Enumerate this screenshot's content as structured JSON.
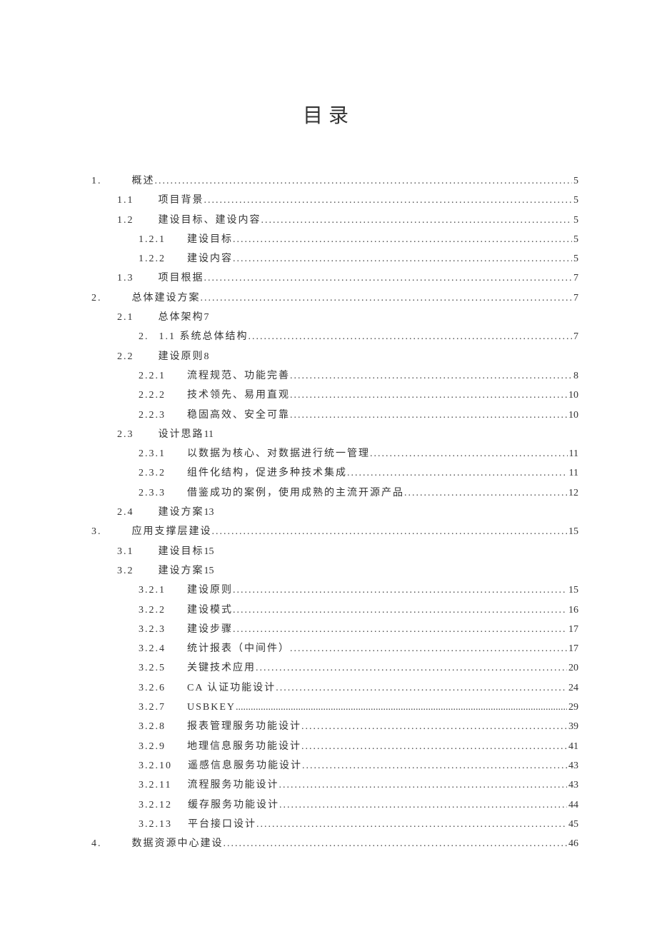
{
  "title": "目录",
  "entries": [
    {
      "indent": 0,
      "number": "1.",
      "gap": 42,
      "title": "概述",
      "page": "5",
      "dots": true
    },
    {
      "indent": 1,
      "number": "1.1",
      "gap": 34,
      "title": "项目背景",
      "page": "5",
      "dots": true
    },
    {
      "indent": 1,
      "number": "1.2",
      "gap": 34,
      "title": "建设目标、建设内容",
      "page": "5",
      "dots": true
    },
    {
      "indent": 2,
      "number": "1.2.1",
      "gap": 30,
      "title": "建设目标",
      "page": "5",
      "dots": true
    },
    {
      "indent": 2,
      "number": "1.2.2",
      "gap": 30,
      "title": "建设内容",
      "page": "5",
      "dots": true
    },
    {
      "indent": 1,
      "number": "1.3",
      "gap": 34,
      "title": "项目根据",
      "page": "7",
      "dots": true
    },
    {
      "indent": 0,
      "number": "2.",
      "gap": 42,
      "title": "总体建设方案",
      "page": "7",
      "dots": true
    },
    {
      "indent": 1,
      "number": "2.1",
      "gap": 34,
      "title": "总体架构",
      "page": "7",
      "dots": false,
      "inlinePage": "7"
    },
    {
      "indent": 2,
      "number": "2.",
      "gap": 14,
      "title": "1.1 系统总体结构",
      "page": "7",
      "dots": true
    },
    {
      "indent": 1,
      "number": "2.2",
      "gap": 34,
      "title": "建设原则",
      "page": "8",
      "dots": false,
      "inlinePage": "8"
    },
    {
      "indent": 2,
      "number": "2.2.1",
      "gap": 30,
      "title": "流程规范、功能完善",
      "page": "8",
      "dots": true
    },
    {
      "indent": 2,
      "number": "2.2.2",
      "gap": 30,
      "title": "技术领先、易用直观",
      "page": "10",
      "dots": true
    },
    {
      "indent": 2,
      "number": "2.2.3",
      "gap": 30,
      "title": "稳固高效、安全可靠",
      "page": "10",
      "dots": true
    },
    {
      "indent": 1,
      "number": "2.3",
      "gap": 34,
      "title": "设计思路",
      "page": "11",
      "dots": false,
      "inlinePage": "11"
    },
    {
      "indent": 2,
      "number": "2.3.1",
      "gap": 30,
      "title": "以数据为核心、对数据进行统一管理",
      "page": "11",
      "dots": true
    },
    {
      "indent": 2,
      "number": "2.3.2",
      "gap": 30,
      "title": "组件化结构，促进多种技术集成",
      "page": "11",
      "dots": true
    },
    {
      "indent": 2,
      "number": "2.3.3",
      "gap": 30,
      "title": "借鉴成功的案例，使用成熟的主流开源产品",
      "page": "12",
      "dots": true
    },
    {
      "indent": 1,
      "number": "2.4",
      "gap": 34,
      "title": "建设方案",
      "page": "13",
      "dots": false,
      "inlinePage": "13"
    },
    {
      "indent": 0,
      "number": "3.",
      "gap": 42,
      "title": "应用支撑层建设",
      "page": "15",
      "dots": true
    },
    {
      "indent": 1,
      "number": "3.1",
      "gap": 34,
      "title": "建设目标",
      "page": "15",
      "dots": false,
      "inlinePage": "15"
    },
    {
      "indent": 1,
      "number": "3.2",
      "gap": 34,
      "title": "建设方案",
      "page": "15",
      "dots": false,
      "inlinePage": "15"
    },
    {
      "indent": 2,
      "number": "3.2.1",
      "gap": 30,
      "title": "建设原则",
      "page": "15",
      "dots": true
    },
    {
      "indent": 2,
      "number": "3.2.2",
      "gap": 30,
      "title": "建设模式",
      "page": "16",
      "dots": true
    },
    {
      "indent": 2,
      "number": "3.2.3",
      "gap": 30,
      "title": "建设步骤",
      "page": "17",
      "dots": true
    },
    {
      "indent": 2,
      "number": "3.2.4",
      "gap": 30,
      "title": "统计报表（中间件）",
      "page": "17",
      "dots": true
    },
    {
      "indent": 2,
      "number": "3.2.5",
      "gap": 30,
      "title": "关键技术应用",
      "page": "20",
      "dots": true
    },
    {
      "indent": 2,
      "number": "3.2.6",
      "gap": 30,
      "title": "CA 认证功能设计",
      "page": "24",
      "dots": true
    },
    {
      "indent": 2,
      "number": "3.2.7",
      "gap": 30,
      "title": "USBKEY",
      "page": "29",
      "dots": true,
      "tight": true
    },
    {
      "indent": 2,
      "number": "3.2.8",
      "gap": 30,
      "title": "报表管理服务功能设计",
      "page": "39",
      "dots": true
    },
    {
      "indent": 2,
      "number": "3.2.9",
      "gap": 30,
      "title": "地理信息服务功能设计",
      "page": "41",
      "dots": true
    },
    {
      "indent": 2,
      "number": "3.2.10",
      "gap": 22,
      "title": "遥感信息服务功能设计",
      "page": "43",
      "dots": true
    },
    {
      "indent": 2,
      "number": "3.2.11",
      "gap": 22,
      "title": "流程服务功能设计",
      "page": "43",
      "dots": true
    },
    {
      "indent": 2,
      "number": "3.2.12",
      "gap": 22,
      "title": "缓存服务功能设计",
      "page": "44",
      "dots": true
    },
    {
      "indent": 2,
      "number": "3.2.13",
      "gap": 22,
      "title": "平台接口设计",
      "page": "45",
      "dots": true
    },
    {
      "indent": 0,
      "number": "4.",
      "gap": 42,
      "title": "数据资源中心建设",
      "page": "46",
      "dots": true
    }
  ]
}
